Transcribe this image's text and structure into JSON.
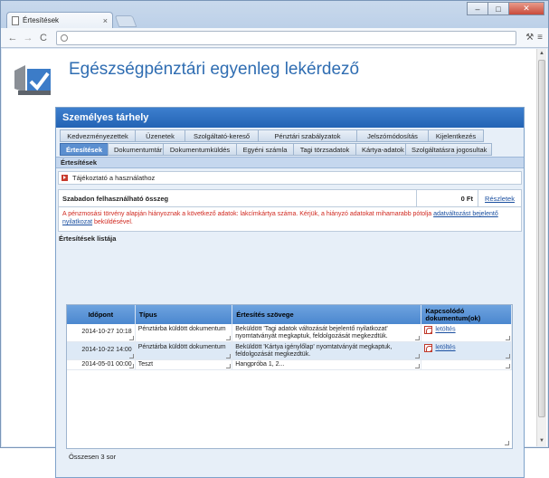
{
  "browser": {
    "tab_title": "Értesítések",
    "tab_close": "×",
    "minimize": "–",
    "maximize": "□",
    "close": "✕",
    "back": "←",
    "forward": "→",
    "reload": "C",
    "wrench": "⚒",
    "menu": "≡"
  },
  "header": {
    "title": "Egészségpénztári egyenleg lekérdező"
  },
  "panel": {
    "title": "Személyes tárhely",
    "nav_row1": [
      "Kedvezményezettek",
      "Üzenetek",
      "Szolgáltató-kereső",
      "Pénztári szabályzatok",
      "Jelszómódosítás",
      "Kijelentkezés"
    ],
    "nav_row2": [
      "Értesítések",
      "Dokumentumtár",
      "Dokumentumküldés",
      "Egyéni számla",
      "Tagi törzsadatok",
      "Kártya-adatok",
      "Szolgáltatásra jogosultak"
    ],
    "active_tab": "Értesítések",
    "subbar": "Értesítések",
    "info": "Tájékoztató a használathoz"
  },
  "balance": {
    "label": "Szabadon felhasználható összeg",
    "amount": "0 Ft",
    "details_link": "Részletek"
  },
  "warning": {
    "text_before": "A pénzmosási törvény alapján hiányoznak a következő adatok: lakcímkártya száma. Kérjük, a hiányzó adatokat mihamarabb pótolja ",
    "link": "adatváltozást bejelentő nyilatkozat",
    "text_after": " beküldésével."
  },
  "notifications": {
    "heading": "Értesítések listája",
    "columns": [
      "Időpont",
      "Típus",
      "Értesítés szövege",
      "Kapcsolódó dokumentum(ok)"
    ],
    "rows": [
      {
        "time": "2014-10-27 10:18",
        "type": "Pénztárba küldött dokumentum",
        "text": "Beküldött 'Tagi adatok változását bejelentő nyilatkozat' nyomtatványát megkaptuk, feldolgozását megkezdtük.",
        "doc": "letöltés"
      },
      {
        "time": "2014-10-22 14:00",
        "type": "Pénztárba küldött dokumentum",
        "text": "Beküldött 'Kártya igénylőlap' nyomtatványát megkaptuk, feldolgozását megkezdtük.",
        "doc": "letöltés"
      },
      {
        "time": "2014-05-01 00:00",
        "type": "Teszt",
        "text": "Hangpróba 1, 2...",
        "doc": ""
      }
    ],
    "total": "Összesen 3 sor"
  },
  "colors": {
    "title_blue": "#2f6db2",
    "panel_header": "#2363b4",
    "warning_red": "#d0281f",
    "link_blue": "#1a4fa0"
  }
}
